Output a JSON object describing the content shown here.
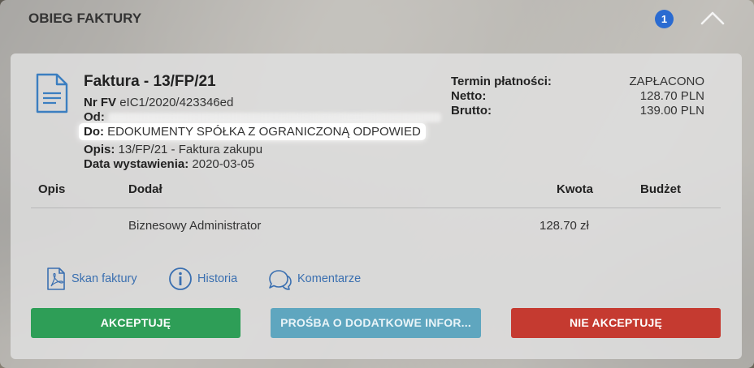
{
  "header": {
    "title": "OBIEG FAKTURY",
    "badge_count": "1"
  },
  "invoice": {
    "title": "Faktura - 13/FP/21",
    "nr_label": "Nr FV",
    "nr_value": "eIC1/2020/423346ed",
    "od_label": "Od:",
    "do_label": "Do:",
    "do_value": "EDOKUMENTY SPÓŁKA Z OGRANICZONĄ ODPOWIED",
    "opis_label": "Opis:",
    "opis_value": "13/FP/21 - Faktura zakupu",
    "date_label": "Data wystawienia:",
    "date_value": "2020-03-05"
  },
  "payment": {
    "termin_label": "Termin płatności:",
    "termin_value": "ZAPŁACONO",
    "netto_label": "Netto:",
    "netto_value": "128.70 PLN",
    "brutto_label": "Brutto:",
    "brutto_value": "139.00 PLN"
  },
  "table": {
    "headers": [
      "Opis",
      "Dodał",
      "Kwota",
      "Budżet"
    ],
    "rows": [
      {
        "opis": "",
        "dodal": "Biznesowy Administrator",
        "kwota": "128.70 zł",
        "budzet": ""
      }
    ]
  },
  "links": {
    "scan": "Skan faktury",
    "history": "Historia",
    "comments": "Komentarze"
  },
  "buttons": {
    "accept": "AKCEPTUJĘ",
    "request_info": "PROŚBA O DODATKOWE INFOR...",
    "reject": "NIE AKCEPTUJĘ"
  },
  "icons": {
    "document": "document-icon",
    "pdf": "pdf-icon",
    "info": "info-icon",
    "comments": "comments-icon",
    "collapse": "chevron-up-icon"
  },
  "colors": {
    "accept": "#2e9e57",
    "request_info": "#5fa6bf",
    "reject": "#c53a30",
    "link": "#3a6fb0",
    "badge": "#2a6bd1"
  }
}
